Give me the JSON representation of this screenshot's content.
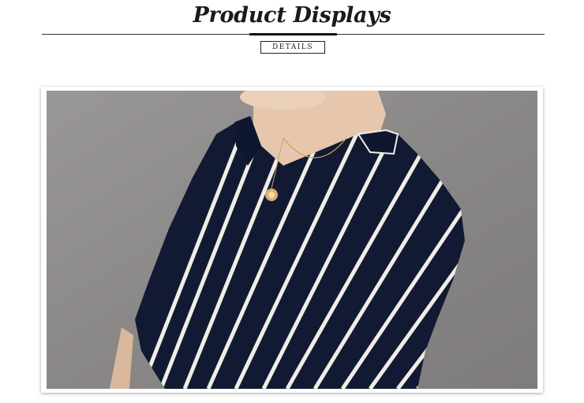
{
  "header": {
    "title": "Product Displays",
    "details_label": "DETAILS"
  },
  "photo": {
    "subject": "model-in-striped-shirt",
    "colors": {
      "background": "#8d8a8a",
      "shirt": "#121a33",
      "stripe": "#f1ede6",
      "skin": "#e6c7ad"
    }
  }
}
